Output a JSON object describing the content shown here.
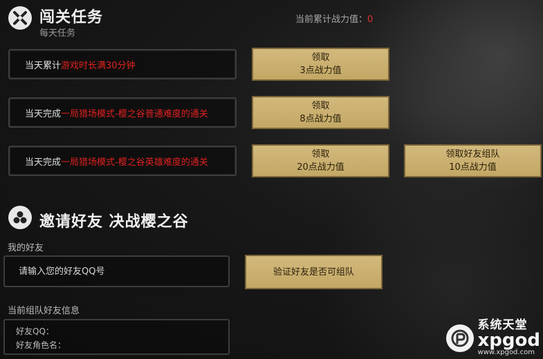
{
  "daily": {
    "title": "闯关任务",
    "subtitle": "每天任务",
    "total_label": "当前累计战力值：",
    "total_value": "0"
  },
  "tasks": [
    {
      "prefix": "当天累计",
      "highlight": "游戏时长满30分钟",
      "btn_label": "领取",
      "btn_reward": "3点战力值"
    },
    {
      "prefix": "当天完成",
      "highlight": "一局猎场模式-樱之谷普通难度的通关",
      "btn_label": "领取",
      "btn_reward": "8点战力值"
    },
    {
      "prefix": "当天完成",
      "highlight": "一局猎场模式-樱之谷英雄难度的通关",
      "btn_label": "领取",
      "btn_reward": "20点战力值",
      "extra_btn_label": "领取好友组队",
      "extra_btn_reward": "10点战力值"
    }
  ],
  "invite": {
    "title": "邀请好友 决战樱之谷",
    "friends_label": "我的好友",
    "input_placeholder": "请输入您的好友QQ号",
    "verify_button": "验证好友是否可组队",
    "team_info_label": "当前组队好友信息",
    "friend_qq_label": "好友QQ：",
    "friend_role_label": "好友角色名："
  },
  "watermark": {
    "cn": "系统天堂",
    "en": "xpgod",
    "url": "www.xpgod.com"
  },
  "colors": {
    "accent_red": "#e02020",
    "gold_button": "#c8ae6c"
  }
}
